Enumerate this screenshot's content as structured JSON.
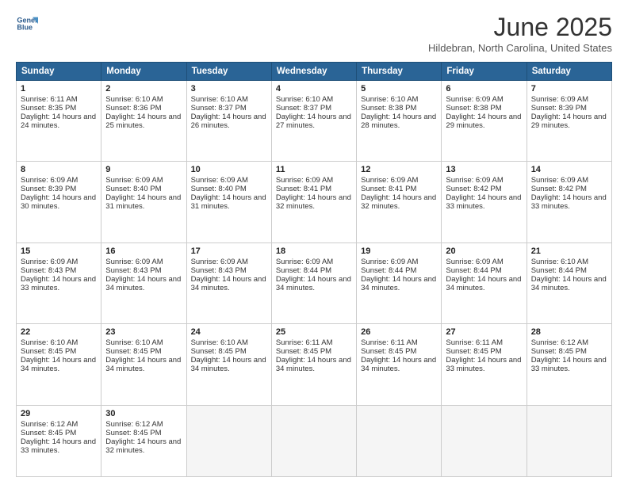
{
  "logo": {
    "line1": "General",
    "line2": "Blue"
  },
  "title": "June 2025",
  "location": "Hildebran, North Carolina, United States",
  "days_header": [
    "Sunday",
    "Monday",
    "Tuesday",
    "Wednesday",
    "Thursday",
    "Friday",
    "Saturday"
  ],
  "weeks": [
    [
      {
        "day": "1",
        "sunrise": "6:11 AM",
        "sunset": "8:35 PM",
        "daylight": "14 hours and 24 minutes."
      },
      {
        "day": "2",
        "sunrise": "6:10 AM",
        "sunset": "8:36 PM",
        "daylight": "14 hours and 25 minutes."
      },
      {
        "day": "3",
        "sunrise": "6:10 AM",
        "sunset": "8:37 PM",
        "daylight": "14 hours and 26 minutes."
      },
      {
        "day": "4",
        "sunrise": "6:10 AM",
        "sunset": "8:37 PM",
        "daylight": "14 hours and 27 minutes."
      },
      {
        "day": "5",
        "sunrise": "6:10 AM",
        "sunset": "8:38 PM",
        "daylight": "14 hours and 28 minutes."
      },
      {
        "day": "6",
        "sunrise": "6:09 AM",
        "sunset": "8:38 PM",
        "daylight": "14 hours and 29 minutes."
      },
      {
        "day": "7",
        "sunrise": "6:09 AM",
        "sunset": "8:39 PM",
        "daylight": "14 hours and 29 minutes."
      }
    ],
    [
      {
        "day": "8",
        "sunrise": "6:09 AM",
        "sunset": "8:39 PM",
        "daylight": "14 hours and 30 minutes."
      },
      {
        "day": "9",
        "sunrise": "6:09 AM",
        "sunset": "8:40 PM",
        "daylight": "14 hours and 31 minutes."
      },
      {
        "day": "10",
        "sunrise": "6:09 AM",
        "sunset": "8:40 PM",
        "daylight": "14 hours and 31 minutes."
      },
      {
        "day": "11",
        "sunrise": "6:09 AM",
        "sunset": "8:41 PM",
        "daylight": "14 hours and 32 minutes."
      },
      {
        "day": "12",
        "sunrise": "6:09 AM",
        "sunset": "8:41 PM",
        "daylight": "14 hours and 32 minutes."
      },
      {
        "day": "13",
        "sunrise": "6:09 AM",
        "sunset": "8:42 PM",
        "daylight": "14 hours and 33 minutes."
      },
      {
        "day": "14",
        "sunrise": "6:09 AM",
        "sunset": "8:42 PM",
        "daylight": "14 hours and 33 minutes."
      }
    ],
    [
      {
        "day": "15",
        "sunrise": "6:09 AM",
        "sunset": "8:43 PM",
        "daylight": "14 hours and 33 minutes."
      },
      {
        "day": "16",
        "sunrise": "6:09 AM",
        "sunset": "8:43 PM",
        "daylight": "14 hours and 34 minutes."
      },
      {
        "day": "17",
        "sunrise": "6:09 AM",
        "sunset": "8:43 PM",
        "daylight": "14 hours and 34 minutes."
      },
      {
        "day": "18",
        "sunrise": "6:09 AM",
        "sunset": "8:44 PM",
        "daylight": "14 hours and 34 minutes."
      },
      {
        "day": "19",
        "sunrise": "6:09 AM",
        "sunset": "8:44 PM",
        "daylight": "14 hours and 34 minutes."
      },
      {
        "day": "20",
        "sunrise": "6:09 AM",
        "sunset": "8:44 PM",
        "daylight": "14 hours and 34 minutes."
      },
      {
        "day": "21",
        "sunrise": "6:10 AM",
        "sunset": "8:44 PM",
        "daylight": "14 hours and 34 minutes."
      }
    ],
    [
      {
        "day": "22",
        "sunrise": "6:10 AM",
        "sunset": "8:45 PM",
        "daylight": "14 hours and 34 minutes."
      },
      {
        "day": "23",
        "sunrise": "6:10 AM",
        "sunset": "8:45 PM",
        "daylight": "14 hours and 34 minutes."
      },
      {
        "day": "24",
        "sunrise": "6:10 AM",
        "sunset": "8:45 PM",
        "daylight": "14 hours and 34 minutes."
      },
      {
        "day": "25",
        "sunrise": "6:11 AM",
        "sunset": "8:45 PM",
        "daylight": "14 hours and 34 minutes."
      },
      {
        "day": "26",
        "sunrise": "6:11 AM",
        "sunset": "8:45 PM",
        "daylight": "14 hours and 34 minutes."
      },
      {
        "day": "27",
        "sunrise": "6:11 AM",
        "sunset": "8:45 PM",
        "daylight": "14 hours and 33 minutes."
      },
      {
        "day": "28",
        "sunrise": "6:12 AM",
        "sunset": "8:45 PM",
        "daylight": "14 hours and 33 minutes."
      }
    ],
    [
      {
        "day": "29",
        "sunrise": "6:12 AM",
        "sunset": "8:45 PM",
        "daylight": "14 hours and 33 minutes."
      },
      {
        "day": "30",
        "sunrise": "6:12 AM",
        "sunset": "8:45 PM",
        "daylight": "14 hours and 32 minutes."
      },
      null,
      null,
      null,
      null,
      null
    ]
  ]
}
